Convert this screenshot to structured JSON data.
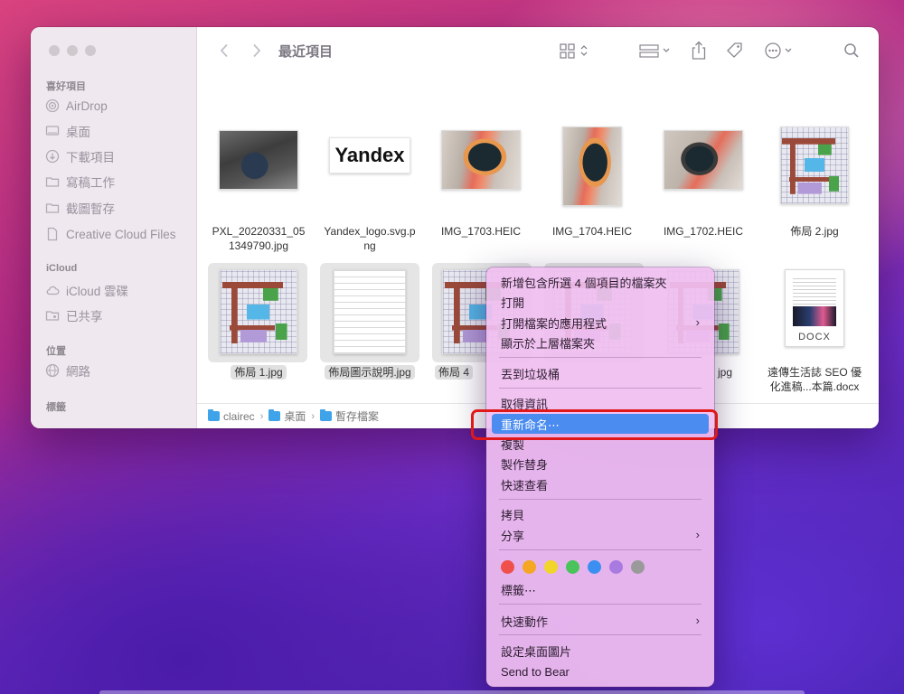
{
  "window": {
    "title": "最近項目"
  },
  "sidebar": {
    "sections": {
      "favorites": "喜好項目",
      "icloud": "iCloud",
      "locations": "位置",
      "tags": "標籤"
    },
    "favorites": [
      {
        "label": "AirDrop",
        "icon": "airdrop-icon"
      },
      {
        "label": "桌面",
        "icon": "desktop-icon"
      },
      {
        "label": "下載項目",
        "icon": "download-icon"
      },
      {
        "label": "寫稿工作",
        "icon": "folder-icon"
      },
      {
        "label": "截圖暫存",
        "icon": "folder-icon"
      },
      {
        "label": "Creative Cloud Files",
        "icon": "document-icon"
      }
    ],
    "icloud": [
      {
        "label": "iCloud 雲碟",
        "icon": "cloud-icon"
      },
      {
        "label": "已共享",
        "icon": "shared-folder-icon"
      }
    ],
    "locations": [
      {
        "label": "網路",
        "icon": "globe-icon"
      }
    ]
  },
  "files": [
    {
      "name": "PXL_20220331_05\n1349790.jpg",
      "kind": "photo-phone",
      "selected": false
    },
    {
      "name": "Yandex_logo.svg.p\nng",
      "kind": "logo",
      "logo_text": "Yandex",
      "selected": false
    },
    {
      "name": "IMG_1703.HEIC",
      "kind": "photo-watch",
      "selected": false
    },
    {
      "name": "IMG_1704.HEIC",
      "kind": "photo-watch",
      "selected": false
    },
    {
      "name": "IMG_1702.HEIC",
      "kind": "photo-watch2",
      "selected": false
    },
    {
      "name": "佈局 2.jpg",
      "kind": "plan",
      "selected": false
    },
    {
      "name": "佈局 1.jpg",
      "kind": "plan",
      "selected": true
    },
    {
      "name": "佈局圖示說明.jpg",
      "kind": "legend",
      "selected": true
    },
    {
      "name": "佈局 4",
      "kind": "plan",
      "selected": true
    },
    {
      "name": "",
      "kind": "plan",
      "selected": true
    },
    {
      "name": "jpg",
      "kind": "plan-narrow",
      "selected": false
    },
    {
      "name": "遠傳生活誌 SEO 優\n化進稿...本篇.docx",
      "kind": "docx",
      "doc_badge": "DOCX",
      "selected": false
    }
  ],
  "pathbar": [
    "clairec",
    "桌面",
    "暫存檔案"
  ],
  "context_menu": {
    "items": [
      {
        "label": "新增包含所選 4 個項目的檔案夾",
        "submenu": false
      },
      {
        "label": "打開",
        "submenu": false
      },
      {
        "label": "打開檔案的應用程式",
        "submenu": true
      },
      {
        "label": "顯示於上層檔案夾",
        "submenu": false
      },
      {
        "label": "丟到垃圾桶",
        "submenu": false
      },
      {
        "label": "取得資訊",
        "submenu": false
      },
      {
        "label": "重新命名⋯",
        "submenu": false,
        "highlighted": true
      },
      {
        "label": "複製",
        "submenu": false
      },
      {
        "label": "製作替身",
        "submenu": false
      },
      {
        "label": "快速查看",
        "submenu": false
      },
      {
        "label": "拷貝",
        "submenu": false
      },
      {
        "label": "分享",
        "submenu": true
      },
      {
        "label": "標籤⋯",
        "submenu": false
      },
      {
        "label": "快速動作",
        "submenu": true
      },
      {
        "label": "設定桌面圖片",
        "submenu": false
      },
      {
        "label": "Send to Bear",
        "submenu": false
      }
    ],
    "tag_colors": [
      "#f0504c",
      "#f5a623",
      "#f2d52a",
      "#49c35a",
      "#3b8ff0",
      "#a97ae0",
      "#9a9a9a"
    ]
  }
}
